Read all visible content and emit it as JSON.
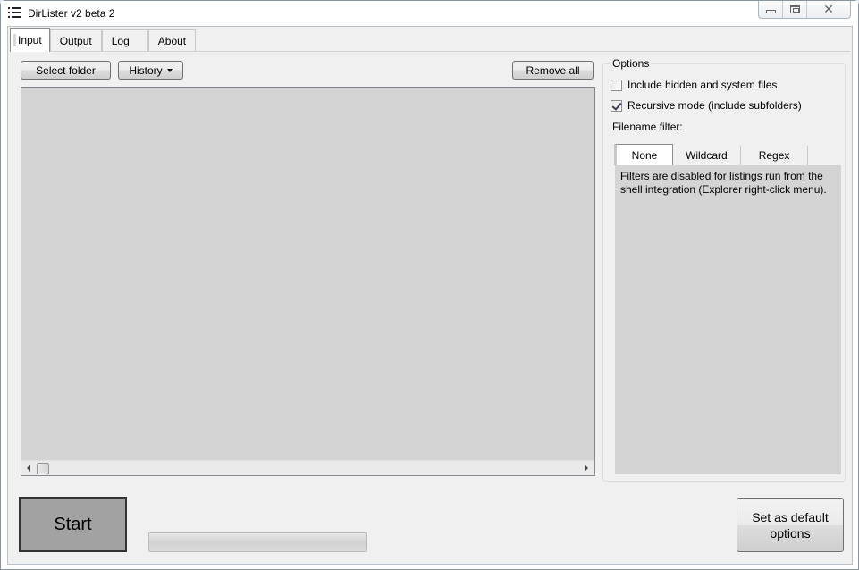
{
  "window": {
    "title": "DirLister v2 beta 2",
    "icon": "list-icon",
    "caption_buttons": [
      "minimize",
      "maximize",
      "close"
    ]
  },
  "tabs": [
    {
      "label": "Input",
      "active": true
    },
    {
      "label": "Output",
      "active": false
    },
    {
      "label": "Log",
      "active": false
    },
    {
      "label": "About",
      "active": false
    }
  ],
  "input": {
    "select_folder_label": "Select folder",
    "history_label": "History",
    "remove_all_label": "Remove all",
    "folders": []
  },
  "options": {
    "group_label": "Options",
    "include_hidden": {
      "label": "Include hidden and system files",
      "checked": false
    },
    "recursive": {
      "label": "Recursive mode (include subfolders)",
      "checked": true
    },
    "filter_label": "Filename filter:",
    "filter_tabs": [
      {
        "label": "None",
        "active": true
      },
      {
        "label": "Wildcard",
        "active": false
      },
      {
        "label": "Regex",
        "active": false
      }
    ],
    "filter_message": "Filters are disabled for listings run from the shell integration (Explorer right-click menu)."
  },
  "footer": {
    "start_label": "Start",
    "progress_percent": 0,
    "set_default_label": "Set as default options"
  }
}
